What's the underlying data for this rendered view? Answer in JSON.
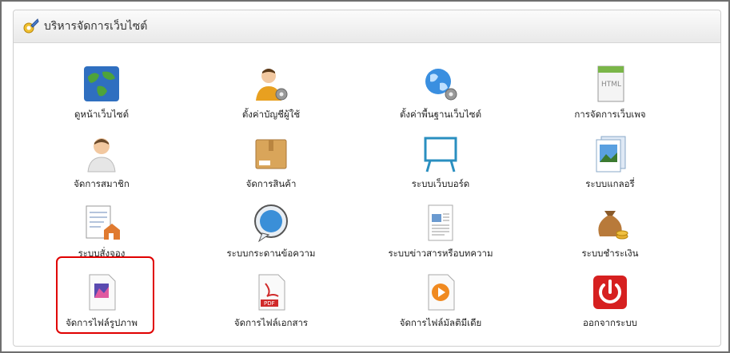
{
  "panel": {
    "title": "บริหารจัดการเว็บไซต์"
  },
  "tiles": [
    {
      "label": "ดูหน้าเว็บไซต์",
      "icon": "globe-icon"
    },
    {
      "label": "ตั้งค่าบัญชีผู้ใช้",
      "icon": "user-settings-icon"
    },
    {
      "label": "ตั้งค่าพื้นฐานเว็บไซต์",
      "icon": "globe-settings-icon"
    },
    {
      "label": "การจัดการเว็บเพจ",
      "icon": "html-page-icon"
    },
    {
      "label": "จัดการสมาชิก",
      "icon": "member-icon"
    },
    {
      "label": "จัดการสินค้า",
      "icon": "product-box-icon"
    },
    {
      "label": "ระบบเว็บบอร์ด",
      "icon": "webboard-icon"
    },
    {
      "label": "ระบบแกลอรี่",
      "icon": "gallery-icon"
    },
    {
      "label": "ระบบสั่งจอง",
      "icon": "order-form-icon"
    },
    {
      "label": "ระบบกระดานข้อความ",
      "icon": "speech-bubble-icon"
    },
    {
      "label": "ระบบข่าวสารหรือบทความ",
      "icon": "news-article-icon"
    },
    {
      "label": "ระบบชำระเงิน",
      "icon": "money-bag-icon"
    },
    {
      "label": "จัดการไฟล์รูปภาพ",
      "icon": "image-file-icon"
    },
    {
      "label": "จัดการไฟล์เอกสาร",
      "icon": "pdf-file-icon"
    },
    {
      "label": "จัดการไฟล์มัลติมีเดีย",
      "icon": "media-file-icon"
    },
    {
      "label": "ออกจากระบบ",
      "icon": "power-icon"
    }
  ],
  "highlight_color": "#e00000"
}
